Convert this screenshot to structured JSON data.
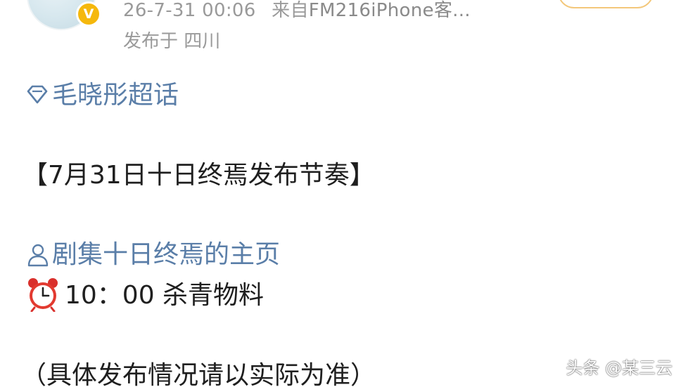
{
  "header": {
    "timestamp": "26-7-31 00:06",
    "source_prefix": "来自",
    "source_app": "FM216iPhone客...",
    "location": "发布于 四川",
    "verified_badge": "V"
  },
  "post": {
    "supertopic": "毛晓彤超话",
    "title": "【7月31日十日终焉发布节奏】",
    "mention": "剧集十日终焉的主页",
    "schedule_item": "10：00 杀青物料",
    "note": "（具体发布情况请以实际为准）"
  },
  "icons": {
    "supertopic": "diamond-icon",
    "mention": "person-icon",
    "schedule": "alarm-clock-icon",
    "verified": "verified-badge-icon"
  },
  "watermark": "头条 @某三云",
  "colors": {
    "link": "#5a7ea8",
    "meta": "#9a9a9a",
    "verified_badge": "#f5b80c",
    "follow_border": "#f3c77a"
  }
}
